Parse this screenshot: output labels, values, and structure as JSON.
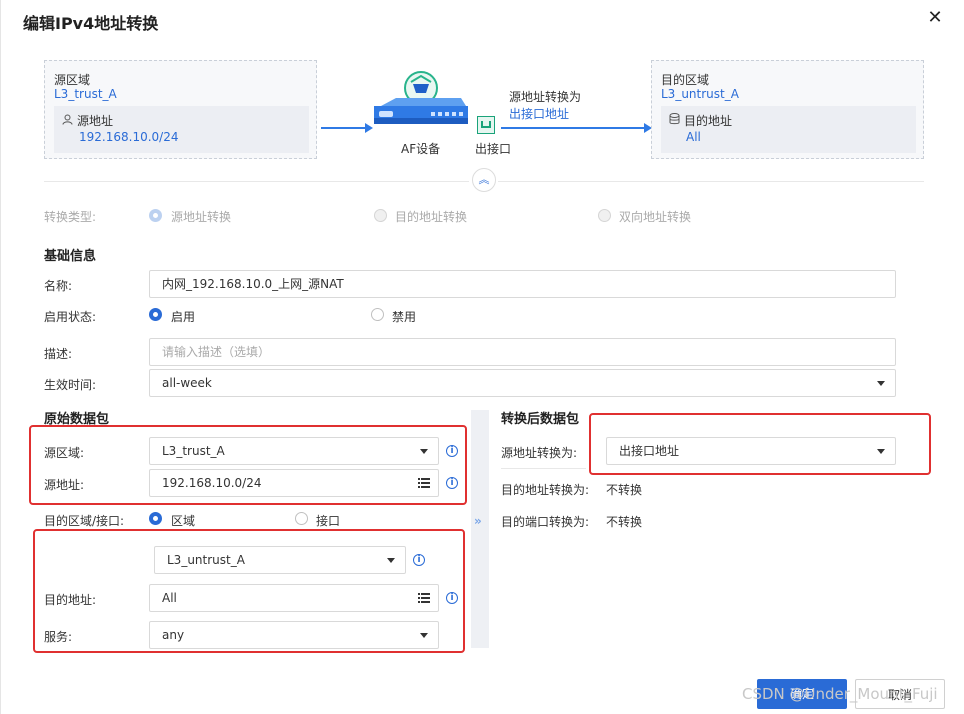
{
  "dialog": {
    "title": "编辑IPv4地址转换"
  },
  "diagram": {
    "source_zone_label": "源区域",
    "source_zone_value": "L3_trust_A",
    "source_addr_label": "源地址",
    "source_addr_value": "192.168.10.0/24",
    "device_label": "AF设备",
    "egress_label": "出接口",
    "translate_label": "源地址转换为",
    "translate_value": "出接口地址",
    "dest_zone_label": "目的区域",
    "dest_zone_value": "L3_untrust_A",
    "dest_addr_label": "目的地址",
    "dest_addr_value": "All"
  },
  "conversion": {
    "label": "转换类型:",
    "options": [
      "源地址转换",
      "目的地址转换",
      "双向地址转换"
    ]
  },
  "basic": {
    "section": "基础信息",
    "name_label": "名称:",
    "name_value": "内网_192.168.10.0_上网_源NAT",
    "status_label": "启用状态:",
    "status_on": "启用",
    "status_off": "禁用",
    "desc_label": "描述:",
    "desc_placeholder": "请输入描述（选填）",
    "time_label": "生效时间:",
    "time_value": "all-week"
  },
  "original": {
    "section": "原始数据包",
    "src_zone_label": "源区域:",
    "src_zone_value": "L3_trust_A",
    "src_addr_label": "源地址:",
    "src_addr_value": "192.168.10.0/24",
    "dst_type_label": "目的区域/接口:",
    "dst_type_zone": "区域",
    "dst_type_iface": "接口",
    "dst_zone_value": "L3_untrust_A",
    "dst_addr_label": "目的地址:",
    "dst_addr_value": "All",
    "service_label": "服务:",
    "service_value": "any"
  },
  "translated": {
    "section": "转换后数据包",
    "src_label": "源地址转换为:",
    "src_value": "出接口地址",
    "dst_label": "目的地址转换为:",
    "dst_value": "不转换",
    "port_label": "目的端口转换为:",
    "port_value": "不转换"
  },
  "footer": {
    "ok": "确定",
    "cancel": "取消",
    "watermark": "CSDN @Under_Mount_Fuji"
  },
  "colors": {
    "accent": "#2a6bd6",
    "highlight": "#e03030"
  }
}
